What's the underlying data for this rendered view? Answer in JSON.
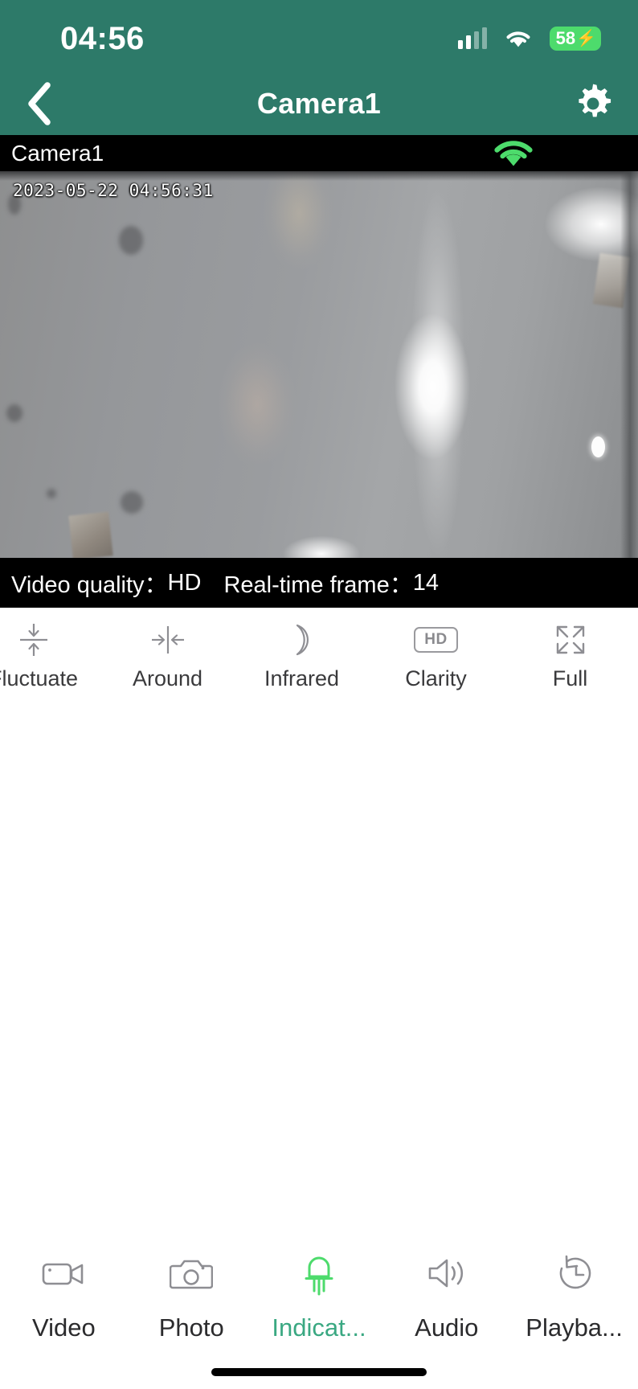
{
  "status_bar": {
    "time": "04:56",
    "signal_icon": "cellular-signal-icon",
    "wifi_icon": "wifi-icon",
    "battery_percent": "58",
    "battery_charging_glyph": "⚡",
    "battery_color": "#4ddb6c"
  },
  "nav_bar": {
    "back_icon": "chevron-left-icon",
    "title": "Camera1",
    "settings_icon": "gear-icon",
    "background_color": "#2d7a69"
  },
  "camera_strip": {
    "name": "Camera1",
    "wifi_icon": "wifi-signal-icon",
    "wifi_color": "#4ddb6c"
  },
  "video": {
    "timestamp": "2023-05-22 04:56:31"
  },
  "info_bar": {
    "quality_label": "Video quality：",
    "quality_value": "HD",
    "frame_label": "Real-time frame：",
    "frame_value": "14"
  },
  "controls": [
    {
      "label": "Fluctuate",
      "icon": "fluctuate-arrows-icon"
    },
    {
      "label": "Around",
      "icon": "around-arrows-icon"
    },
    {
      "label": "Infrared",
      "icon": "moon-icon"
    },
    {
      "label": "Clarity",
      "icon": "hd-badge-icon",
      "chip": "HD"
    },
    {
      "label": "Full",
      "icon": "fullscreen-expand-icon"
    }
  ],
  "tabs": [
    {
      "label": "Video",
      "icon": "camcorder-icon",
      "active": false
    },
    {
      "label": "Photo",
      "icon": "camera-icon",
      "active": false
    },
    {
      "label": "Indicat...",
      "icon": "indicator-led-icon",
      "active": true
    },
    {
      "label": "Audio",
      "icon": "speaker-icon",
      "active": false
    },
    {
      "label": "Playba...",
      "icon": "playback-history-icon",
      "active": false
    }
  ],
  "accent_color": "#3aa882"
}
